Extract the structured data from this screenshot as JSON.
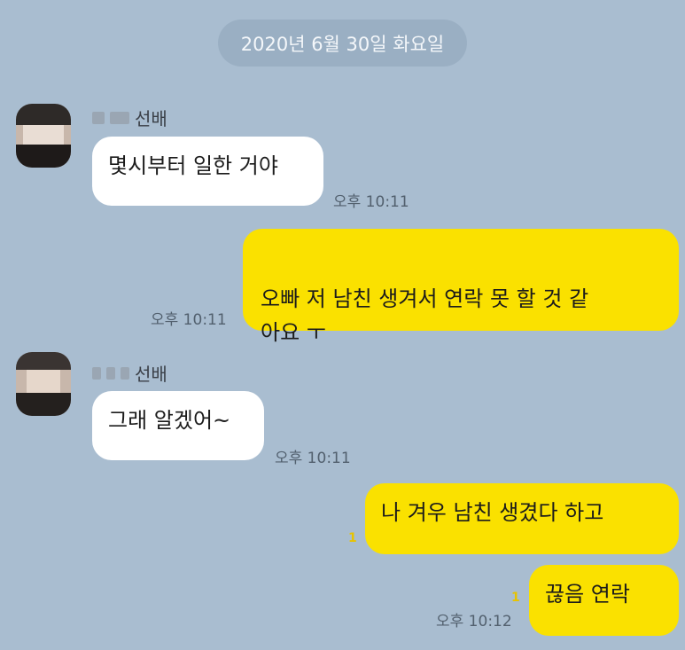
{
  "date_divider": "2020년 6월 30일 화요일",
  "messages": [
    {
      "sender": "선배",
      "text": "몇시부터 일한 거야",
      "time": "오후 10:11"
    },
    {
      "text": "오빠 저 남친 생겨서 연락 못 할 것 같\n아요 ㅜ",
      "time": "오후 10:11"
    },
    {
      "sender": "선배",
      "text": "그래 알겠어~",
      "time": "오후 10:11"
    },
    {
      "text": "나 겨우 남친 생겼다 하고",
      "unread": "1"
    },
    {
      "text": "끊음 연락",
      "unread": "1",
      "time": "오후 10:12"
    }
  ],
  "colors": {
    "background": "#a9bdd0",
    "outgoing_bubble": "#fae100",
    "incoming_bubble": "#ffffff",
    "unread_count": "#e7c300"
  }
}
